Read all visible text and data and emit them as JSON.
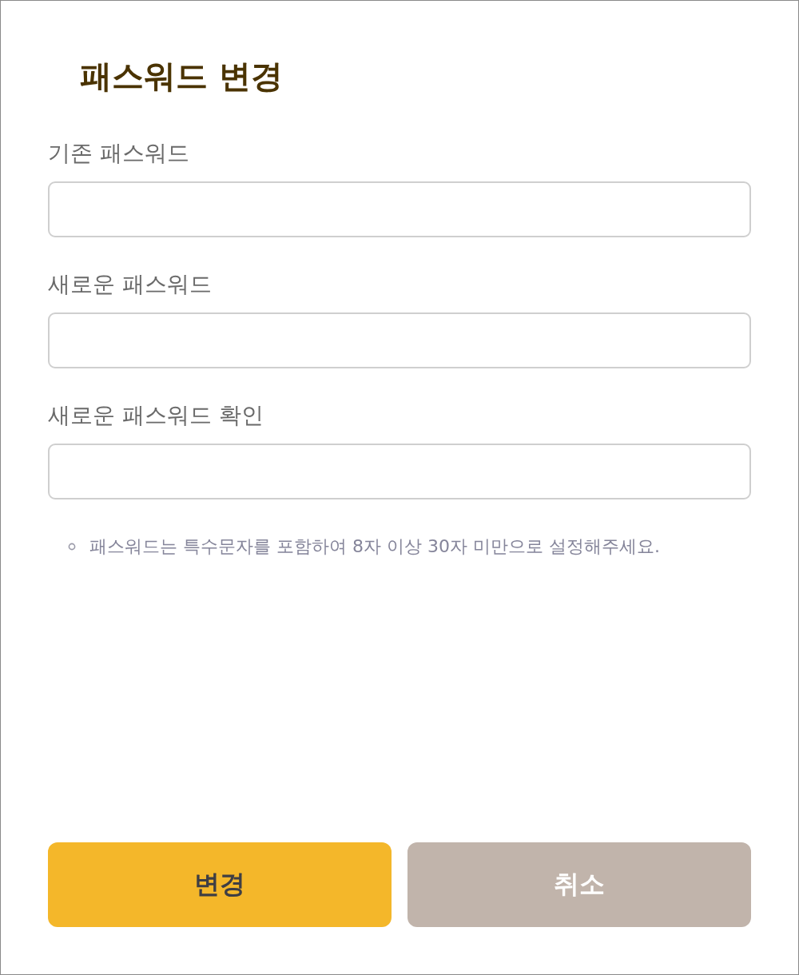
{
  "dialog": {
    "title": "패스워드 변경"
  },
  "fields": [
    {
      "label": "기존 패스워드"
    },
    {
      "label": "새로운 패스워드"
    },
    {
      "label": "새로운 패스워드 확인"
    }
  ],
  "notes": [
    "패스워드는 특수문자를 포함하여 8자 이상 30자 미만으로 설정해주세요."
  ],
  "buttons": [
    {
      "label": "변경",
      "kind": "primary"
    },
    {
      "label": "취소",
      "kind": "secondary"
    }
  ]
}
